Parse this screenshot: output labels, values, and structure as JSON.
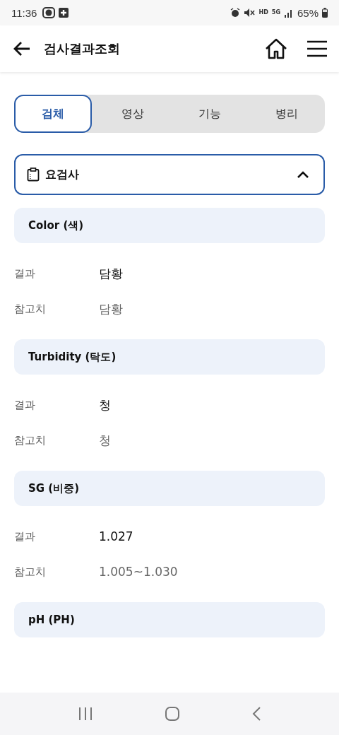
{
  "status_bar": {
    "time": "11:36",
    "badges": [
      "HD",
      "5G"
    ],
    "battery": "65%"
  },
  "header": {
    "title": "검사결과조회"
  },
  "tabs": [
    {
      "label": "검체",
      "selected": true
    },
    {
      "label": "영상",
      "selected": false
    },
    {
      "label": "기능",
      "selected": false
    },
    {
      "label": "병리",
      "selected": false
    }
  ],
  "accordion": {
    "title": "요검사",
    "expanded": true
  },
  "tests": [
    {
      "name": "Color (색)",
      "rows": [
        {
          "kind": "result",
          "label": "결과",
          "value": "담황"
        },
        {
          "kind": "reference",
          "label": "참고치",
          "value": "담황"
        }
      ]
    },
    {
      "name": "Turbidity (탁도)",
      "rows": [
        {
          "kind": "result",
          "label": "결과",
          "value": "청"
        },
        {
          "kind": "reference",
          "label": "참고치",
          "value": "청"
        }
      ]
    },
    {
      "name": "SG (비중)",
      "rows": [
        {
          "kind": "result",
          "label": "결과",
          "value": "1.027"
        },
        {
          "kind": "reference",
          "label": "참고치",
          "value": "1.005~1.030"
        }
      ]
    },
    {
      "name": "pH (PH)"
    }
  ]
}
